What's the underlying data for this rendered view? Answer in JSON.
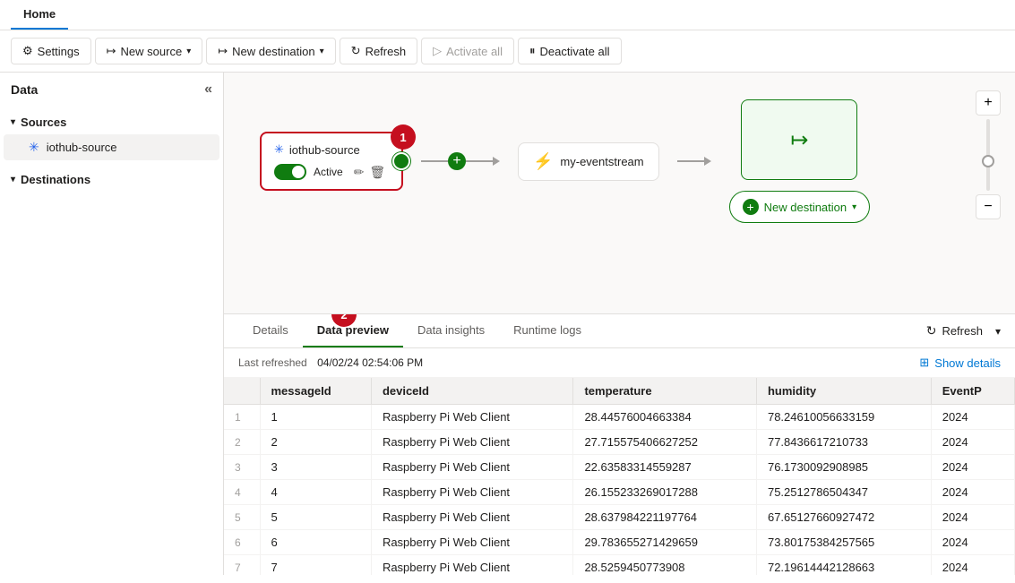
{
  "tabs": {
    "active": "Home",
    "items": [
      "Home"
    ]
  },
  "toolbar": {
    "settings_label": "Settings",
    "new_source_label": "New source",
    "new_destination_label": "New destination",
    "refresh_label": "Refresh",
    "activate_all_label": "Activate all",
    "deactivate_all_label": "Deactivate all"
  },
  "sidebar": {
    "title": "Data",
    "sources_label": "Sources",
    "destinations_label": "Destinations",
    "source_item": "iothub-source"
  },
  "canvas": {
    "source_name": "iothub-source",
    "source_status": "Active",
    "eventstream_name": "my-eventstream",
    "new_destination_label": "New destination"
  },
  "panel": {
    "tabs": [
      "Details",
      "Data preview",
      "Data insights",
      "Runtime logs"
    ],
    "active_tab": "Data preview",
    "refresh_label": "Refresh",
    "last_refreshed_label": "Last refreshed",
    "last_refreshed_value": "04/02/24 02:54:06 PM",
    "show_details_label": "Show details"
  },
  "table": {
    "columns": [
      "messageId",
      "deviceId",
      "temperature",
      "humidity",
      "EventP"
    ],
    "rows": [
      [
        "1",
        "Raspberry Pi Web Client",
        "28.44576004663384",
        "78.24610056633159",
        "2024"
      ],
      [
        "2",
        "Raspberry Pi Web Client",
        "27.715575406627252",
        "77.8436617210733",
        "2024"
      ],
      [
        "3",
        "Raspberry Pi Web Client",
        "22.63583314559287",
        "76.1730092908985",
        "2024"
      ],
      [
        "4",
        "Raspberry Pi Web Client",
        "26.155233269017288",
        "75.2512786504347",
        "2024"
      ],
      [
        "5",
        "Raspberry Pi Web Client",
        "28.637984221197764",
        "67.65127660927472",
        "2024"
      ],
      [
        "6",
        "Raspberry Pi Web Client",
        "29.783655271429659",
        "73.80175384257565",
        "2024"
      ],
      [
        "7",
        "Raspberry Pi Web Client",
        "28.5259450773908",
        "72.19614442128663",
        "2024"
      ]
    ]
  }
}
